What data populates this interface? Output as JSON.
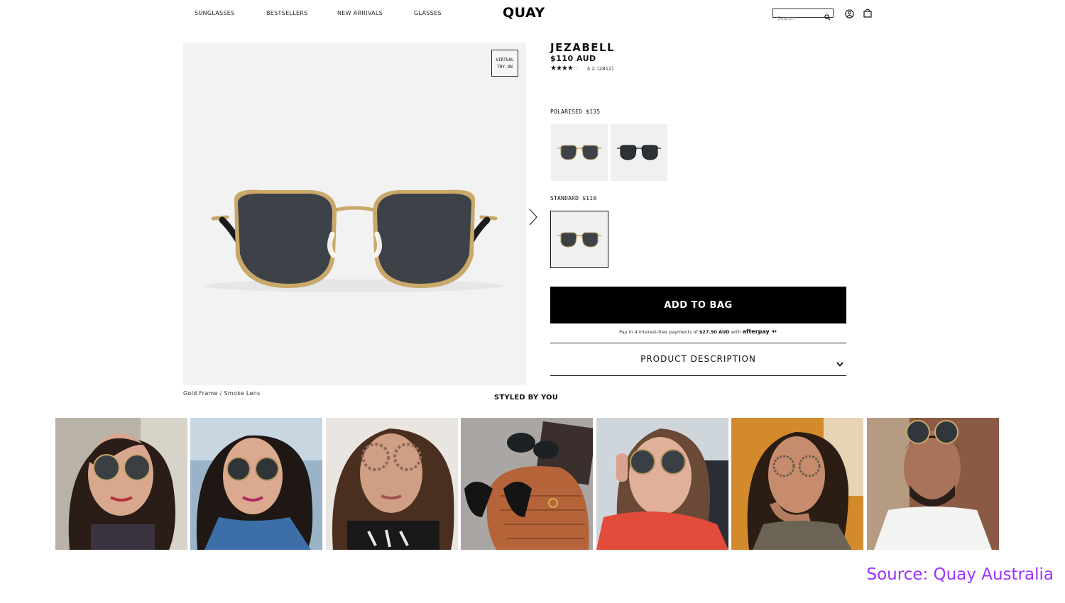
{
  "header": {
    "nav": [
      "SUNGLASSES",
      "BESTSELLERS",
      "NEW ARRIVALS",
      "GLASSES"
    ],
    "logo": "QUAY",
    "search_placeholder": "Search",
    "icons": [
      "search-icon",
      "account-icon",
      "bag-icon"
    ]
  },
  "product": {
    "virtual_try_on": [
      "VIRTUAL",
      "TRY-ON"
    ],
    "caption": "Gold Frame / Smoke Lens",
    "name": "JEZABELL",
    "price": "$110 AUD",
    "rating": {
      "stars": 4,
      "max": 5,
      "score": "4.2",
      "count": "(2812)"
    },
    "polarised_label": "POLARISED $135",
    "standard_label": "STANDARD $110",
    "add_to_bag": "ADD TO BAG",
    "afterpay": {
      "prefix": "Pay in 4 interest-free payments of",
      "amount": "$27.50 AUD",
      "suffix": "with",
      "brand": "afterpay"
    },
    "description_label": "PRODUCT DESCRIPTION"
  },
  "styled_by_you": {
    "title": "STYLED BY YOU",
    "photo_count": 7
  },
  "source": "Source: Quay Australia",
  "colors": {
    "accent": "#000000",
    "image_bg": "#f2f2f2",
    "source_text": "#9b30ff"
  }
}
